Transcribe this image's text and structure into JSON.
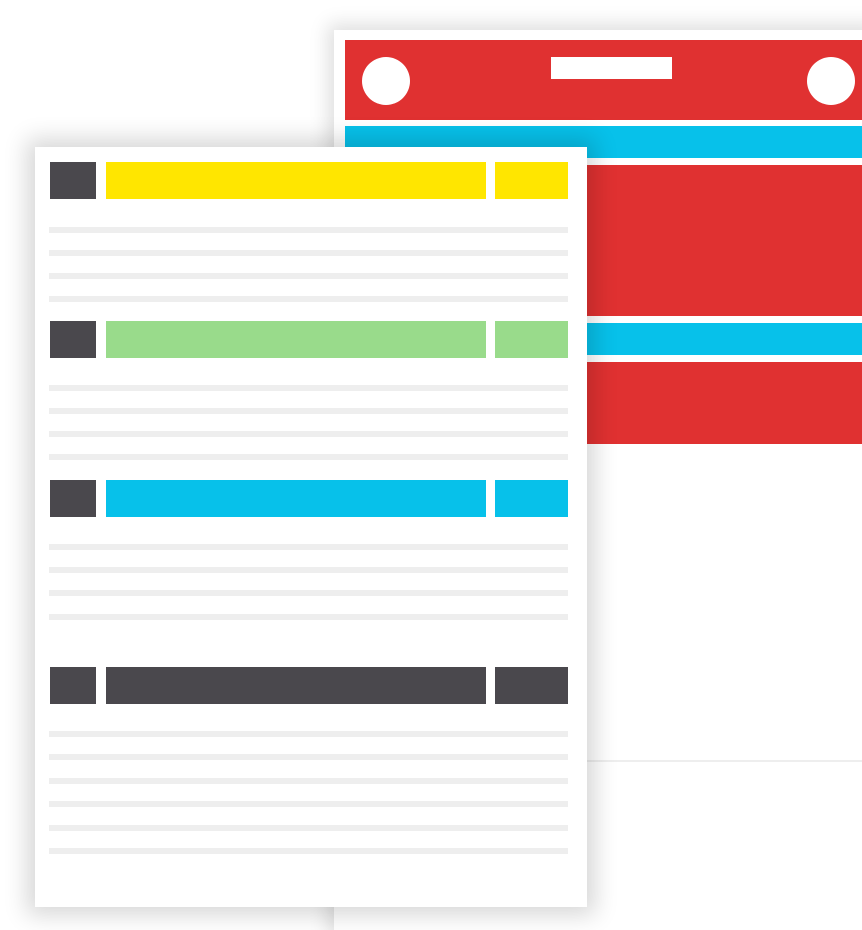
{
  "colors": {
    "red": "#e03131",
    "cyan": "#07c1ea",
    "yellow": "#ffe600",
    "green": "#99db8b",
    "dark": "#4a484d",
    "line": "#eeeeee"
  },
  "back_document": {
    "header_color": "#e03131",
    "bands": [
      "#07c1ea",
      "#07c1ea"
    ],
    "blocks": [
      "#e03131",
      "#e03131"
    ]
  },
  "front_document": {
    "sections": [
      {
        "name": "section-1",
        "color": "#ffe600",
        "text_lines": 4
      },
      {
        "name": "section-2",
        "color": "#99db8b",
        "text_lines": 4
      },
      {
        "name": "section-3",
        "color": "#07c1ea",
        "text_lines": 4
      },
      {
        "name": "section-4",
        "color": "#4a484d",
        "text_lines": 6
      }
    ]
  }
}
